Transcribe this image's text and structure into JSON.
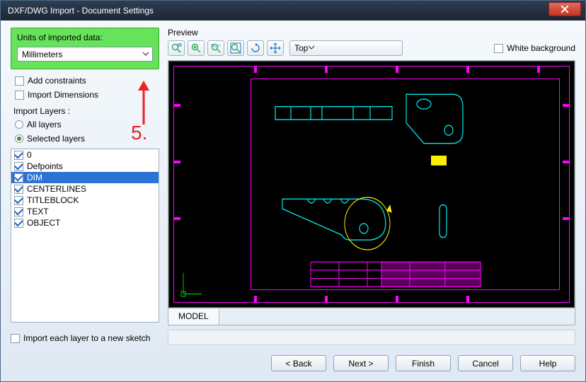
{
  "window": {
    "title": "DXF/DWG Import - Document Settings"
  },
  "units": {
    "group_label": "Units of imported data:",
    "selected": "Millimeters"
  },
  "options": {
    "add_constraints": "Add constraints",
    "import_dimensions": "Import Dimensions"
  },
  "layers": {
    "section_label": "Import Layers :",
    "radio_all": "All layers",
    "radio_selected": "Selected layers",
    "selected_mode": "selected",
    "items": [
      {
        "name": "0",
        "checked": true,
        "selected": false
      },
      {
        "name": "Defpoints",
        "checked": true,
        "selected": false
      },
      {
        "name": "DIM",
        "checked": true,
        "selected": true
      },
      {
        "name": "CENTERLINES",
        "checked": true,
        "selected": false
      },
      {
        "name": "TITLEBLOCK",
        "checked": true,
        "selected": false
      },
      {
        "name": "TEXT",
        "checked": true,
        "selected": false
      },
      {
        "name": "OBJECT",
        "checked": true,
        "selected": false
      }
    ]
  },
  "import_each_layer": "Import each layer to a new sketch",
  "preview": {
    "label": "Preview",
    "toolbar_icons": [
      "zoom-window",
      "zoom-in",
      "zoom-out",
      "zoom-fit",
      "rotate-view",
      "pan"
    ],
    "view_selected": "Top",
    "white_bg_label": "White background",
    "tab": "MODEL"
  },
  "buttons": {
    "back": "< Back",
    "next": "Next >",
    "finish": "Finish",
    "cancel": "Cancel",
    "help": "Help"
  },
  "annotation": {
    "number": "5."
  }
}
